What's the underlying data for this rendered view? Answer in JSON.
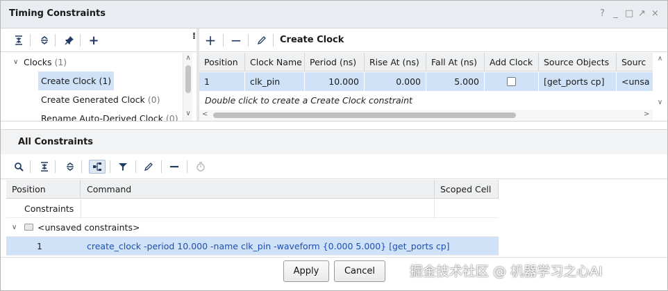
{
  "window": {
    "title": "Timing Constraints",
    "controls": [
      "?",
      "_",
      "□",
      "↗",
      "×"
    ]
  },
  "tree": {
    "items": [
      {
        "label": "Clocks",
        "count": "(1)",
        "expanded": true
      },
      {
        "label": "Create Clock",
        "count": "(1)",
        "selected": true
      },
      {
        "label": "Create Generated Clock",
        "count": "(0)"
      },
      {
        "label": "Rename Auto-Derived Clock",
        "count": "(0)"
      }
    ]
  },
  "left_toolbar": {
    "icons": [
      "collapse-all-icon",
      "expand-all-icon",
      "pin-icon",
      "add-icon"
    ],
    "add_glyph": "+"
  },
  "right_panel": {
    "title": "Create Clock",
    "add_glyph": "+",
    "remove_glyph": "−"
  },
  "clock_table": {
    "columns": [
      "Position",
      "Clock Name",
      "Period (ns)",
      "Rise At (ns)",
      "Fall At (ns)",
      "Add Clock",
      "Source Objects",
      "Sourc"
    ],
    "row": {
      "position": "1",
      "clock_name": "clk_pin",
      "period": "10.000",
      "rise_at": "0.000",
      "fall_at": "5.000",
      "add_clock": false,
      "source_objects": "[get_ports cp]",
      "source": "<unsa"
    },
    "hint": "Double click to create a Create Clock constraint"
  },
  "all_constraints": {
    "title": "All Constraints",
    "columns": [
      "Position",
      "Command",
      "Scoped Cell"
    ],
    "rows": {
      "constraints_label": "Constraints",
      "group_label": "<unsaved constraints>",
      "position": "1",
      "command": "create_clock -period 10.000 -name clk_pin -waveform {0.000 5.000} [get_ports cp]"
    }
  },
  "buttons": {
    "apply": "Apply",
    "cancel": "Cancel"
  },
  "watermark": "掘金技术社区 @ 机器学习之心AI",
  "colors": {
    "selection": "#cfe2f7",
    "header_bg": "#eef0f2",
    "command_text": "#1f4fae",
    "icon": "#223b62"
  }
}
